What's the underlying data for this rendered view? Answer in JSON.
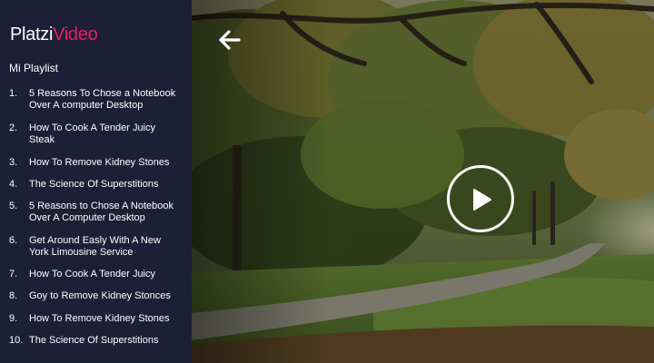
{
  "logo": {
    "part1": "Platzi",
    "part2": "Video"
  },
  "playlist": {
    "heading": "Mi Playlist",
    "items": [
      {
        "num": "1.",
        "title": "5 Reasons To Chose a Notebook Over A computer Desktop"
      },
      {
        "num": "2.",
        "title": "How To Cook A Tender Juicy Steak"
      },
      {
        "num": "3.",
        "title": "How To Remove Kidney Stones"
      },
      {
        "num": "4.",
        "title": "The Science Of Superstitions"
      },
      {
        "num": "5.",
        "title": "5 Reasons to Chose A Notebook Over A Computer Desktop"
      },
      {
        "num": "6.",
        "title": "Get Around Easly With A New York Limousine Service"
      },
      {
        "num": "7.",
        "title": "How To Cook A Tender Juicy"
      },
      {
        "num": "8.",
        "title": "Goy to Remove Kidney Stonces"
      },
      {
        "num": "9.",
        "title": "How To Remove Kidney Stones"
      },
      {
        "num": "10.",
        "title": "The Science Of Superstitions"
      }
    ]
  },
  "player": {
    "back_icon": "arrow-left-icon",
    "play_icon": "play-icon"
  },
  "colors": {
    "sidebar_bg": "#1c1f36",
    "logo_accent": "#e91e63",
    "text": "#ffffff"
  }
}
